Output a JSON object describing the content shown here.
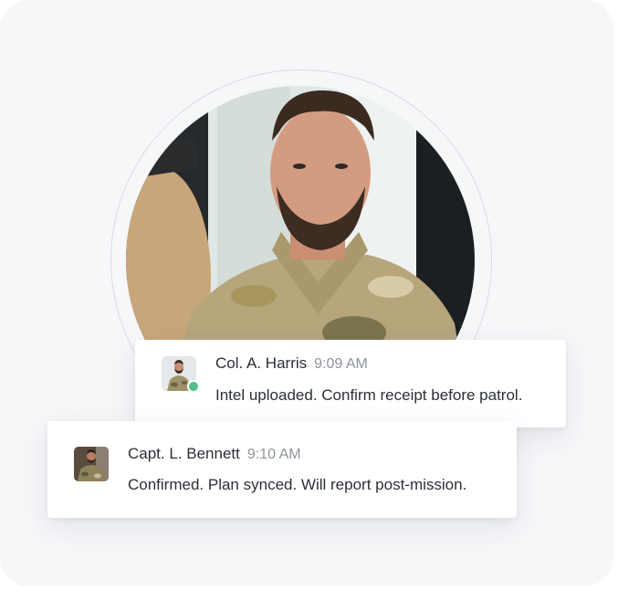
{
  "portrait": {
    "icon": "portrait-photo",
    "description_icon": "soldier-portrait"
  },
  "messages": [
    {
      "author": "Col. A. Harris",
      "time": "9:09 AM",
      "text": "Intel uploaded. Confirm receipt before patrol.",
      "online": true,
      "avatar_icon": "avatar-photo"
    },
    {
      "author": "Capt. L. Bennett",
      "time": "9:10 AM",
      "text": "Confirmed. Plan synced. Will report post-mission.",
      "online": false,
      "avatar_icon": "avatar-photo"
    }
  ],
  "colors": {
    "background": "#f6f7f9",
    "online": "#4fc188",
    "name": "#2b2f36",
    "time": "#8e939b"
  }
}
